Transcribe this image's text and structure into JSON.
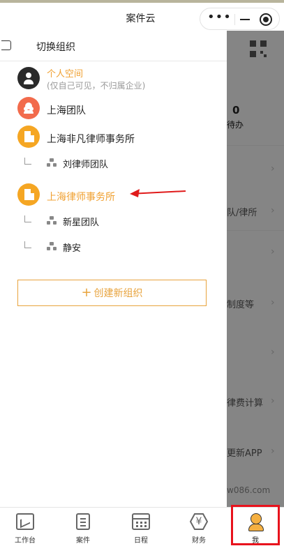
{
  "colors": {
    "accent": "#f0a030",
    "highlight_box": "#e8121c",
    "arrow": "#e01a1a"
  },
  "window": {
    "title": "案件云"
  },
  "drawer": {
    "header_title": "切换组织",
    "orgs": [
      {
        "name": "个人空间",
        "subtitle": "(仅自己可见，不归属企业)",
        "icon": "person-icon",
        "active": false
      },
      {
        "name": "上海团队",
        "icon": "team-icon"
      },
      {
        "name": "上海非凡律师事务所",
        "icon": "building-icon"
      },
      {
        "name": "上海律师事务所",
        "icon": "building-icon",
        "active": true
      }
    ],
    "sub_teams": [
      {
        "name": "刘律师团队",
        "parent": "上海非凡律师事务所"
      },
      {
        "name": "新星团队",
        "parent": "上海律师事务所"
      },
      {
        "name": "静安",
        "parent": "上海律师事务所"
      }
    ],
    "create_button": {
      "plus": "+",
      "label": "创建新组织"
    }
  },
  "background": {
    "count_value": "0",
    "count_label": "待办",
    "items": [
      "队/律所",
      "制度等",
      "律费计算",
      "更新APP",
      "w086.com"
    ]
  },
  "tabbar": {
    "tabs": [
      {
        "label": "工作台",
        "icon": "chart-icon"
      },
      {
        "label": "案件",
        "icon": "document-icon"
      },
      {
        "label": "日程",
        "icon": "calendar-icon"
      },
      {
        "label": "财务",
        "icon": "yen-icon",
        "glyph": "¥"
      },
      {
        "label": "我",
        "icon": "person-icon",
        "active": true
      }
    ]
  }
}
